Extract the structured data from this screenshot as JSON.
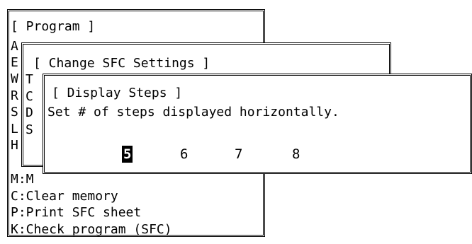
{
  "program_menu": {
    "title": "[ Program ]",
    "partial_letters": [
      "A",
      "E",
      "W",
      "R",
      "S",
      "L",
      "H"
    ],
    "visible_items": [
      {
        "label": "M:M"
      },
      {
        "label": "C:Clear memory"
      },
      {
        "label": "P:Print SFC sheet"
      },
      {
        "label": "K:Check program (SFC)"
      }
    ]
  },
  "change_sfc_menu": {
    "title": "[ Change SFC Settings ]",
    "partial_letters": [
      "T",
      "C",
      "D",
      "S"
    ]
  },
  "display_steps": {
    "title": "[ Display Steps ]",
    "instruction": "Set # of steps displayed horizontally.",
    "options": [
      "5",
      "6",
      "7",
      "8"
    ],
    "selected": "5"
  }
}
